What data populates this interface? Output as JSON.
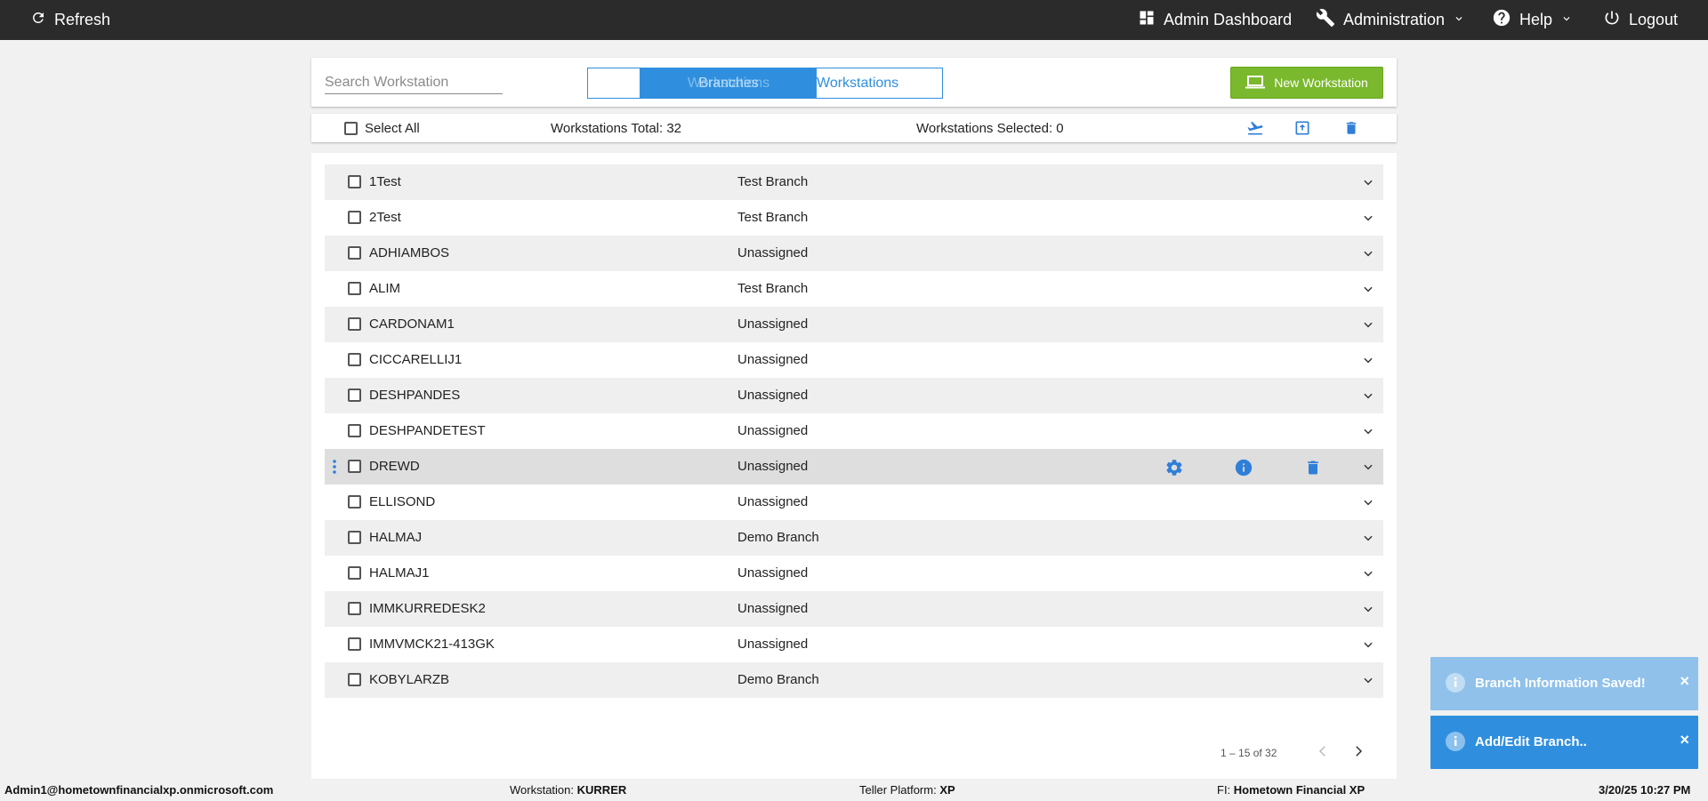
{
  "topbar": {
    "refresh_label": "Refresh",
    "admin_dashboard_label": "Admin Dashboard",
    "administration_label": "Administration",
    "help_label": "Help",
    "logout_label": "Logout"
  },
  "header": {
    "search_placeholder": "Search Workstation",
    "toggle_overlap_a": "Workstations",
    "toggle_overlap_b": "Branches",
    "toggle_right_label": "Workstations",
    "new_button_label": "New Workstation"
  },
  "selection": {
    "select_all_label": "Select All",
    "total_label": "Workstations Total: 32",
    "selected_label": "Workstations Selected: 0"
  },
  "rows": [
    {
      "name": "1Test",
      "branch": "Test Branch"
    },
    {
      "name": "2Test",
      "branch": "Test Branch"
    },
    {
      "name": "ADHIAMBOS",
      "branch": "Unassigned"
    },
    {
      "name": "ALIM",
      "branch": "Test Branch"
    },
    {
      "name": "CARDONAM1",
      "branch": "Unassigned"
    },
    {
      "name": "CICCARELLIJ1",
      "branch": "Unassigned"
    },
    {
      "name": "DESHPANDES",
      "branch": "Unassigned"
    },
    {
      "name": "DESHPANDETEST",
      "branch": "Unassigned"
    },
    {
      "name": "DREWD",
      "branch": "Unassigned"
    },
    {
      "name": "ELLISOND",
      "branch": "Unassigned"
    },
    {
      "name": "HALMAJ",
      "branch": "Demo Branch"
    },
    {
      "name": "HALMAJ1",
      "branch": "Unassigned"
    },
    {
      "name": "IMMKURREDESK2",
      "branch": "Unassigned"
    },
    {
      "name": "IMMVMCK21-413GK",
      "branch": "Unassigned"
    },
    {
      "name": "KOBYLARZB",
      "branch": "Demo Branch"
    }
  ],
  "highlighted_row_index": 8,
  "pager": {
    "range_label": "1 – 15 of 32"
  },
  "toasts": [
    {
      "text": "Branch Information Saved!",
      "close": "×",
      "color": "#8fc1ea"
    },
    {
      "text": "Add/Edit Branch..",
      "close": "×",
      "color": "#2f8fde"
    }
  ],
  "status": {
    "user": "Admin1@hometownfinancialxp.onmicrosoft.com",
    "workstation_label": "Workstation:",
    "workstation_value": "KURRER",
    "platform_label": "Teller Platform:",
    "platform_value": "XP",
    "fi_label": "FI:",
    "fi_value": "Hometown Financial XP",
    "datetime": "3/20/25 10:27 PM"
  },
  "colors": {
    "topbar": "#2b2b2b",
    "accent_blue": "#2f8fde",
    "new_button_green": "#7ab82d"
  }
}
